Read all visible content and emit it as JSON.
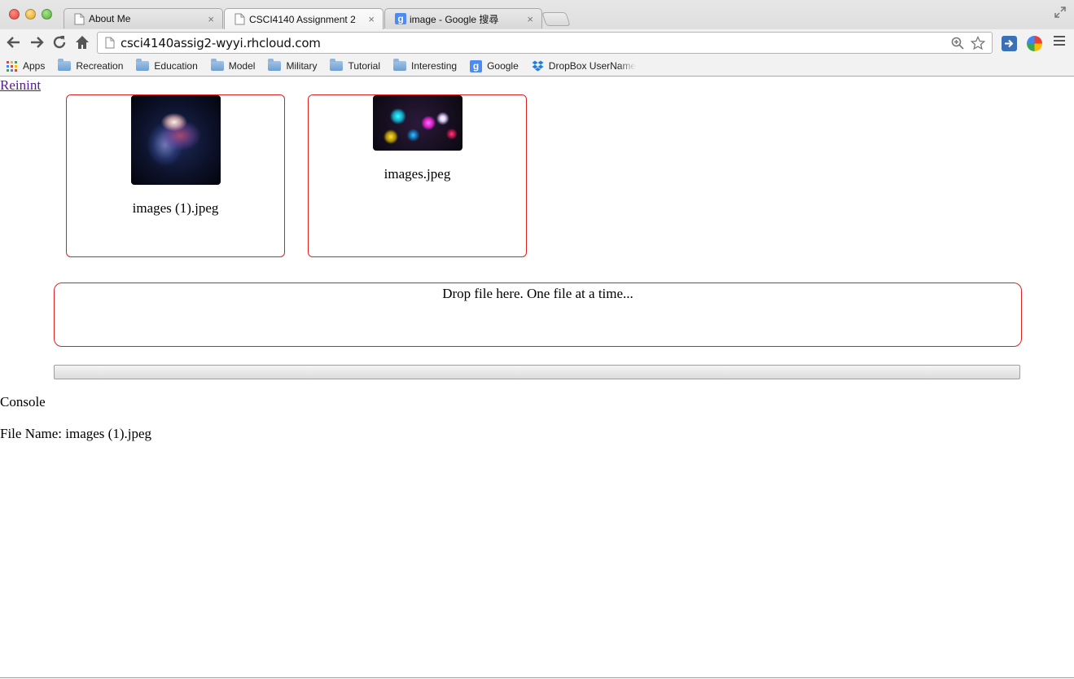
{
  "browser": {
    "tabs": [
      {
        "label": "About Me",
        "icon": "page-icon",
        "active": false
      },
      {
        "label": "CSCI4140 Assignment 2",
        "icon": "page-icon",
        "active": true
      },
      {
        "label": "image - Google 搜尋",
        "icon": "google-icon",
        "active": false
      }
    ],
    "tab_close_glyph": "×",
    "url": "csci4140assig2-wyyi.rhcloud.com",
    "bookmarks": [
      {
        "label": "Apps",
        "icon": "apps-grid-icon"
      },
      {
        "label": "Recreation",
        "icon": "folder-icon"
      },
      {
        "label": "Education",
        "icon": "folder-icon"
      },
      {
        "label": "Model",
        "icon": "folder-icon"
      },
      {
        "label": "Military",
        "icon": "folder-icon"
      },
      {
        "label": "Tutorial",
        "icon": "folder-icon"
      },
      {
        "label": "Interesting",
        "icon": "folder-icon"
      },
      {
        "label": "Google",
        "icon": "google-icon"
      },
      {
        "label": "DropBox UserName",
        "icon": "dropbox-icon"
      }
    ],
    "google_glyph": "g"
  },
  "page": {
    "reinit_link": "Reinint",
    "files": [
      {
        "name": "images (1).jpeg",
        "thumbnail": "galaxy-thumbnail"
      },
      {
        "name": "images.jpeg",
        "thumbnail": "bokeh-lights-thumbnail"
      }
    ],
    "dropzone_text": "Drop file here. One file at a time...",
    "progress": 0,
    "console_title": "Console",
    "console_lines": [
      "File Name: images (1).jpeg"
    ]
  },
  "colors": {
    "card_border": "#e02020",
    "link_visited": "#551a8b"
  }
}
